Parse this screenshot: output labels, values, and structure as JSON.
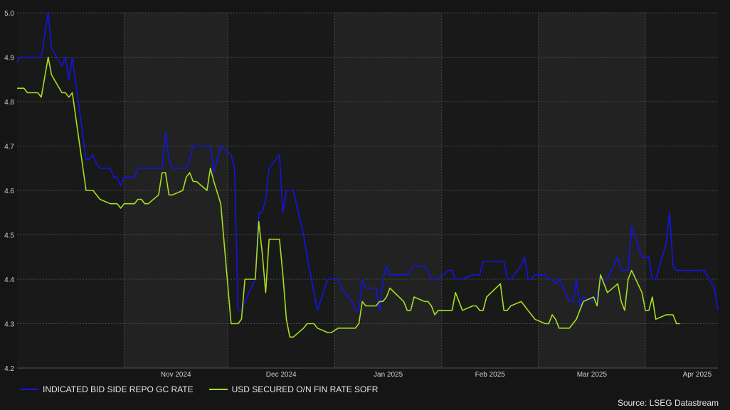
{
  "chart_data": {
    "type": "line",
    "ylim": [
      4.2,
      5.0
    ],
    "y_ticks": [
      "4.2",
      "4.3",
      "4.4",
      "4.5",
      "4.6",
      "4.7",
      "4.8",
      "4.9",
      "5.0"
    ],
    "x_range": [
      "2024-10-01",
      "2025-04-22"
    ],
    "x_ticks": [
      {
        "label": "Nov 2024",
        "date": "2024-11-01"
      },
      {
        "label": "Dec 2024",
        "date": "2024-12-01"
      },
      {
        "label": "Jan 2025",
        "date": "2025-01-01"
      },
      {
        "label": "Feb 2025",
        "date": "2025-02-01"
      },
      {
        "label": "Mar 2025",
        "date": "2025-03-01"
      },
      {
        "label": "Apr 2025",
        "date": "2025-04-01"
      }
    ],
    "grid": true,
    "legend_position": "bottom-left",
    "series": [
      {
        "name": "INDICATED BID SIDE REPO GC RATE",
        "color": "#1414e6",
        "points": [
          [
            "2024-10-01",
            4.89
          ],
          [
            "2024-10-02",
            4.9
          ],
          [
            "2024-10-03",
            4.9
          ],
          [
            "2024-10-04",
            4.9
          ],
          [
            "2024-10-07",
            4.9
          ],
          [
            "2024-10-08",
            4.9
          ],
          [
            "2024-10-10",
            5.0
          ],
          [
            "2024-10-11",
            4.92
          ],
          [
            "2024-10-14",
            4.88
          ],
          [
            "2024-10-15",
            4.9
          ],
          [
            "2024-10-16",
            4.85
          ],
          [
            "2024-10-17",
            4.9
          ],
          [
            "2024-10-21",
            4.67
          ],
          [
            "2024-10-22",
            4.67
          ],
          [
            "2024-10-23",
            4.68
          ],
          [
            "2024-10-24",
            4.66
          ],
          [
            "2024-10-25",
            4.65
          ],
          [
            "2024-10-28",
            4.65
          ],
          [
            "2024-10-29",
            4.63
          ],
          [
            "2024-10-30",
            4.63
          ],
          [
            "2024-10-31",
            4.61
          ],
          [
            "2024-11-01",
            4.63
          ],
          [
            "2024-11-04",
            4.63
          ],
          [
            "2024-11-05",
            4.65
          ],
          [
            "2024-11-06",
            4.65
          ],
          [
            "2024-11-07",
            4.65
          ],
          [
            "2024-11-08",
            4.65
          ],
          [
            "2024-11-11",
            4.65
          ],
          [
            "2024-11-12",
            4.65
          ],
          [
            "2024-11-13",
            4.73
          ],
          [
            "2024-11-14",
            4.67
          ],
          [
            "2024-11-15",
            4.65
          ],
          [
            "2024-11-18",
            4.65
          ],
          [
            "2024-11-19",
            4.65
          ],
          [
            "2024-11-20",
            4.67
          ],
          [
            "2024-11-21",
            4.7
          ],
          [
            "2024-11-22",
            4.7
          ],
          [
            "2024-11-25",
            4.7
          ],
          [
            "2024-11-26",
            4.7
          ],
          [
            "2024-11-27",
            4.64
          ],
          [
            "2024-11-29",
            4.7
          ],
          [
            "2024-12-02",
            4.68
          ],
          [
            "2024-12-03",
            4.65
          ],
          [
            "2024-12-04",
            4.33
          ],
          [
            "2024-12-05",
            4.33
          ],
          [
            "2024-12-06",
            4.35
          ],
          [
            "2024-12-09",
            4.4
          ],
          [
            "2024-12-10",
            4.55
          ],
          [
            "2024-12-11",
            4.55
          ],
          [
            "2024-12-12",
            4.58
          ],
          [
            "2024-12-13",
            4.65
          ],
          [
            "2024-12-16",
            4.68
          ],
          [
            "2024-12-17",
            4.55
          ],
          [
            "2024-12-18",
            4.6
          ],
          [
            "2024-12-19",
            4.6
          ],
          [
            "2024-12-20",
            4.6
          ],
          [
            "2024-12-23",
            4.5
          ],
          [
            "2024-12-24",
            4.45
          ],
          [
            "2024-12-26",
            4.37
          ],
          [
            "2024-12-27",
            4.33
          ],
          [
            "2024-12-30",
            4.4
          ],
          [
            "2024-12-31",
            4.4
          ],
          [
            "2025-01-02",
            4.4
          ],
          [
            "2025-01-03",
            4.38
          ],
          [
            "2025-01-06",
            4.35
          ],
          [
            "2025-01-07",
            4.33
          ],
          [
            "2025-01-08",
            4.33
          ],
          [
            "2025-01-09",
            4.4
          ],
          [
            "2025-01-10",
            4.38
          ],
          [
            "2025-01-13",
            4.38
          ],
          [
            "2025-01-14",
            4.33
          ],
          [
            "2025-01-15",
            4.4
          ],
          [
            "2025-01-16",
            4.43
          ],
          [
            "2025-01-17",
            4.41
          ],
          [
            "2025-01-21",
            4.41
          ],
          [
            "2025-01-22",
            4.41
          ],
          [
            "2025-01-23",
            4.42
          ],
          [
            "2025-01-24",
            4.43
          ],
          [
            "2025-01-27",
            4.43
          ],
          [
            "2025-01-28",
            4.42
          ],
          [
            "2025-01-29",
            4.4
          ],
          [
            "2025-01-30",
            4.4
          ],
          [
            "2025-01-31",
            4.4
          ],
          [
            "2025-02-03",
            4.42
          ],
          [
            "2025-02-04",
            4.42
          ],
          [
            "2025-02-05",
            4.4
          ],
          [
            "2025-02-06",
            4.4
          ],
          [
            "2025-02-07",
            4.4
          ],
          [
            "2025-02-10",
            4.41
          ],
          [
            "2025-02-11",
            4.41
          ],
          [
            "2025-02-12",
            4.41
          ],
          [
            "2025-02-13",
            4.44
          ],
          [
            "2025-02-14",
            4.44
          ],
          [
            "2025-02-18",
            4.44
          ],
          [
            "2025-02-19",
            4.44
          ],
          [
            "2025-02-20",
            4.4
          ],
          [
            "2025-02-21",
            4.4
          ],
          [
            "2025-02-24",
            4.43
          ],
          [
            "2025-02-25",
            4.45
          ],
          [
            "2025-02-26",
            4.4
          ],
          [
            "2025-02-27",
            4.4
          ],
          [
            "2025-02-28",
            4.41
          ],
          [
            "2025-03-03",
            4.41
          ],
          [
            "2025-03-04",
            4.4
          ],
          [
            "2025-03-05",
            4.4
          ],
          [
            "2025-03-06",
            4.39
          ],
          [
            "2025-03-07",
            4.4
          ],
          [
            "2025-03-10",
            4.35
          ],
          [
            "2025-03-11",
            4.35
          ],
          [
            "2025-03-12",
            4.4
          ],
          [
            "2025-03-13",
            4.34
          ],
          [
            "2025-03-14",
            4.36
          ],
          [
            "2025-03-17",
            4.35
          ],
          [
            "2025-03-18",
            4.36
          ],
          [
            "2025-03-19",
            4.4
          ],
          [
            "2025-03-20",
            4.4
          ],
          [
            "2025-03-21",
            4.4
          ],
          [
            "2025-03-24",
            4.45
          ],
          [
            "2025-03-25",
            4.42
          ],
          [
            "2025-03-26",
            4.42
          ],
          [
            "2025-03-27",
            4.42
          ],
          [
            "2025-03-28",
            4.52
          ],
          [
            "2025-03-31",
            4.45
          ],
          [
            "2025-04-01",
            4.45
          ],
          [
            "2025-04-02",
            4.45
          ],
          [
            "2025-04-03",
            4.4
          ],
          [
            "2025-04-04",
            4.4
          ],
          [
            "2025-04-07",
            4.48
          ],
          [
            "2025-04-08",
            4.55
          ],
          [
            "2025-04-09",
            4.43
          ],
          [
            "2025-04-10",
            4.42
          ],
          [
            "2025-04-11",
            4.42
          ],
          [
            "2025-04-14",
            4.42
          ],
          [
            "2025-04-15",
            4.42
          ],
          [
            "2025-04-16",
            4.42
          ],
          [
            "2025-04-17",
            4.42
          ],
          [
            "2025-04-18",
            4.42
          ],
          [
            "2025-04-21",
            4.38
          ],
          [
            "2025-04-22",
            4.33
          ]
        ]
      },
      {
        "name": "USD SECURED O/N FIN RATE SOFR",
        "color": "#a6df1e",
        "points": [
          [
            "2024-10-01",
            4.83
          ],
          [
            "2024-10-02",
            4.83
          ],
          [
            "2024-10-03",
            4.83
          ],
          [
            "2024-10-04",
            4.82
          ],
          [
            "2024-10-07",
            4.82
          ],
          [
            "2024-10-08",
            4.81
          ],
          [
            "2024-10-10",
            4.9
          ],
          [
            "2024-10-11",
            4.86
          ],
          [
            "2024-10-14",
            4.82
          ],
          [
            "2024-10-15",
            4.82
          ],
          [
            "2024-10-16",
            4.81
          ],
          [
            "2024-10-17",
            4.82
          ],
          [
            "2024-10-21",
            4.6
          ],
          [
            "2024-10-22",
            4.6
          ],
          [
            "2024-10-23",
            4.6
          ],
          [
            "2024-10-24",
            4.59
          ],
          [
            "2024-10-25",
            4.58
          ],
          [
            "2024-10-28",
            4.57
          ],
          [
            "2024-10-29",
            4.57
          ],
          [
            "2024-10-30",
            4.57
          ],
          [
            "2024-10-31",
            4.56
          ],
          [
            "2024-11-01",
            4.57
          ],
          [
            "2024-11-04",
            4.57
          ],
          [
            "2024-11-05",
            4.58
          ],
          [
            "2024-11-06",
            4.58
          ],
          [
            "2024-11-07",
            4.57
          ],
          [
            "2024-11-08",
            4.57
          ],
          [
            "2024-11-11",
            4.59
          ],
          [
            "2024-11-12",
            4.64
          ],
          [
            "2024-11-13",
            4.64
          ],
          [
            "2024-11-14",
            4.59
          ],
          [
            "2024-11-15",
            4.59
          ],
          [
            "2024-11-18",
            4.6
          ],
          [
            "2024-11-19",
            4.63
          ],
          [
            "2024-11-20",
            4.64
          ],
          [
            "2024-11-21",
            4.62
          ],
          [
            "2024-11-22",
            4.62
          ],
          [
            "2024-11-25",
            4.6
          ],
          [
            "2024-11-26",
            4.65
          ],
          [
            "2024-11-27",
            4.62
          ],
          [
            "2024-11-29",
            4.57
          ],
          [
            "2024-12-02",
            4.3
          ],
          [
            "2024-12-03",
            4.3
          ],
          [
            "2024-12-04",
            4.3
          ],
          [
            "2024-12-05",
            4.31
          ],
          [
            "2024-12-06",
            4.4
          ],
          [
            "2024-12-09",
            4.4
          ],
          [
            "2024-12-10",
            4.53
          ],
          [
            "2024-12-11",
            4.46
          ],
          [
            "2024-12-12",
            4.37
          ],
          [
            "2024-12-13",
            4.49
          ],
          [
            "2024-12-16",
            4.49
          ],
          [
            "2024-12-17",
            4.41
          ],
          [
            "2024-12-18",
            4.31
          ],
          [
            "2024-12-19",
            4.27
          ],
          [
            "2024-12-20",
            4.27
          ],
          [
            "2024-12-23",
            4.29
          ],
          [
            "2024-12-24",
            4.3
          ],
          [
            "2024-12-26",
            4.3
          ],
          [
            "2024-12-27",
            4.29
          ],
          [
            "2024-12-30",
            4.28
          ],
          [
            "2024-12-31",
            4.28
          ],
          [
            "2025-01-02",
            4.29
          ],
          [
            "2025-01-03",
            4.29
          ],
          [
            "2025-01-06",
            4.29
          ],
          [
            "2025-01-07",
            4.29
          ],
          [
            "2025-01-08",
            4.3
          ],
          [
            "2025-01-09",
            4.35
          ],
          [
            "2025-01-10",
            4.34
          ],
          [
            "2025-01-13",
            4.34
          ],
          [
            "2025-01-14",
            4.35
          ],
          [
            "2025-01-15",
            4.35
          ],
          [
            "2025-01-16",
            4.36
          ],
          [
            "2025-01-17",
            4.38
          ],
          [
            "2025-01-21",
            4.35
          ],
          [
            "2025-01-22",
            4.33
          ],
          [
            "2025-01-23",
            4.33
          ],
          [
            "2025-01-24",
            4.36
          ],
          [
            "2025-01-27",
            4.35
          ],
          [
            "2025-01-28",
            4.35
          ],
          [
            "2025-01-29",
            4.34
          ],
          [
            "2025-01-30",
            4.32
          ],
          [
            "2025-01-31",
            4.33
          ],
          [
            "2025-02-03",
            4.33
          ],
          [
            "2025-02-04",
            4.33
          ],
          [
            "2025-02-05",
            4.37
          ],
          [
            "2025-02-06",
            4.35
          ],
          [
            "2025-02-07",
            4.33
          ],
          [
            "2025-02-10",
            4.34
          ],
          [
            "2025-02-11",
            4.34
          ],
          [
            "2025-02-12",
            4.33
          ],
          [
            "2025-02-13",
            4.33
          ],
          [
            "2025-02-14",
            4.36
          ],
          [
            "2025-02-18",
            4.39
          ],
          [
            "2025-02-19",
            4.33
          ],
          [
            "2025-02-20",
            4.33
          ],
          [
            "2025-02-21",
            4.34
          ],
          [
            "2025-02-24",
            4.35
          ],
          [
            "2025-02-25",
            4.34
          ],
          [
            "2025-02-26",
            4.33
          ],
          [
            "2025-02-27",
            4.32
          ],
          [
            "2025-02-28",
            4.31
          ],
          [
            "2025-03-03",
            4.3
          ],
          [
            "2025-03-04",
            4.3
          ],
          [
            "2025-03-05",
            4.32
          ],
          [
            "2025-03-06",
            4.31
          ],
          [
            "2025-03-07",
            4.29
          ],
          [
            "2025-03-10",
            4.29
          ],
          [
            "2025-03-11",
            4.3
          ],
          [
            "2025-03-12",
            4.31
          ],
          [
            "2025-03-13",
            4.33
          ],
          [
            "2025-03-14",
            4.35
          ],
          [
            "2025-03-17",
            4.36
          ],
          [
            "2025-03-18",
            4.34
          ],
          [
            "2025-03-19",
            4.41
          ],
          [
            "2025-03-20",
            4.39
          ],
          [
            "2025-03-21",
            4.37
          ],
          [
            "2025-03-24",
            4.39
          ],
          [
            "2025-03-25",
            4.35
          ],
          [
            "2025-03-26",
            4.33
          ],
          [
            "2025-03-27",
            4.4
          ],
          [
            "2025-03-28",
            4.42
          ],
          [
            "2025-03-31",
            4.37
          ],
          [
            "2025-04-01",
            4.33
          ],
          [
            "2025-04-02",
            4.33
          ],
          [
            "2025-04-03",
            4.36
          ],
          [
            "2025-04-04",
            4.31
          ],
          [
            "2025-04-07",
            4.32
          ],
          [
            "2025-04-08",
            4.32
          ],
          [
            "2025-04-09",
            4.32
          ],
          [
            "2025-04-10",
            4.3
          ],
          [
            "2025-04-11",
            4.3
          ]
        ]
      }
    ]
  },
  "source_text": "Source: LSEG Datastream"
}
